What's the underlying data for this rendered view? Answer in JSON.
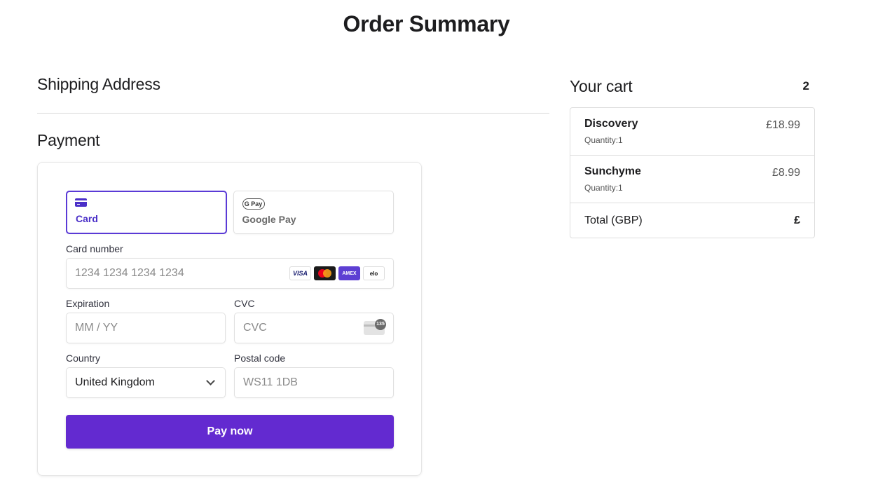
{
  "page": {
    "title": "Order Summary"
  },
  "shipping": {
    "title": "Shipping Address"
  },
  "payment": {
    "title": "Payment",
    "methods": [
      {
        "label": "Card",
        "icon": "credit-card-icon",
        "active": true
      },
      {
        "label": "Google Pay",
        "icon": "google-pay-icon",
        "badge": "G Pay",
        "active": false
      }
    ],
    "card_number": {
      "label": "Card number",
      "placeholder": "1234 1234 1234 1234",
      "brands": [
        "VISA",
        "mastercard",
        "AMEX",
        "elo"
      ]
    },
    "expiration": {
      "label": "Expiration",
      "placeholder": "MM / YY"
    },
    "cvc": {
      "label": "CVC",
      "placeholder": "CVC",
      "icon_text": "135"
    },
    "country": {
      "label": "Country",
      "value": "United Kingdom"
    },
    "postal": {
      "label": "Postal code",
      "placeholder": "WS11 1DB"
    },
    "submit_label": "Pay now",
    "accent_color": "#632ad0"
  },
  "cart": {
    "title": "Your cart",
    "count": "2",
    "items": [
      {
        "name": "Discovery",
        "quantity": "Quantity:1",
        "price": "£18.99"
      },
      {
        "name": "Sunchyme",
        "quantity": "Quantity:1",
        "price": "£8.99"
      }
    ],
    "total_label": "Total (GBP)",
    "total_value": "£"
  }
}
